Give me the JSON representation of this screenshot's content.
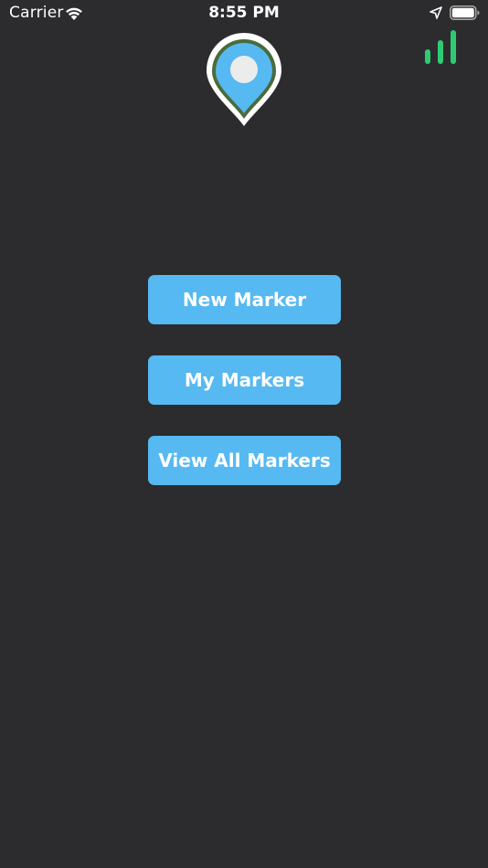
{
  "status_bar": {
    "carrier": "Carrier",
    "time": "8:55 PM",
    "icons": [
      "wifi-icon",
      "location-arrow-icon",
      "battery-icon"
    ]
  },
  "header": {
    "logo_icon": "map-pin-icon",
    "signal_icon": "signal-strength-icon",
    "signal_color": "#2ecc71"
  },
  "menu": {
    "new_marker_label": "New Marker",
    "my_markers_label": "My Markers",
    "view_all_markers_label": "View All Markers"
  },
  "colors": {
    "background": "#2c2c2e",
    "button": "#56b9f1",
    "button_text": "#ffffff",
    "pin_fill": "#56b9f1",
    "pin_border": "#4a6b3a"
  }
}
